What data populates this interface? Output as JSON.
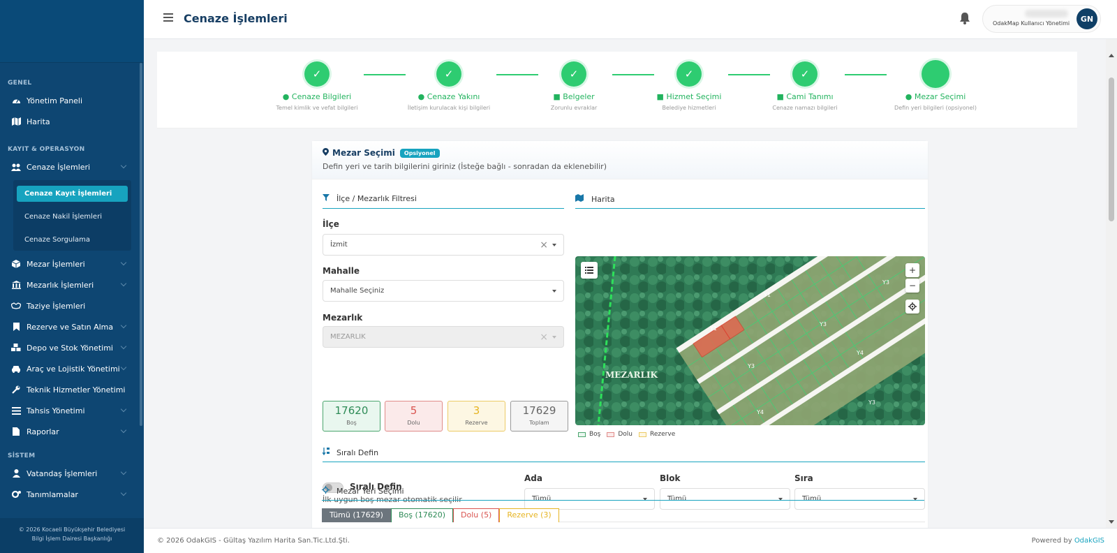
{
  "header": {
    "title": "Cenaze İşlemleri",
    "user_role": "OdakMap Kullanıcı Yönetimi",
    "avatar_initials": "GN"
  },
  "sidebar": {
    "sections": [
      "GENEL",
      "KAYIT & OPERASYON",
      "SİSTEM"
    ],
    "genel": [
      {
        "label": "Yönetim Paneli",
        "icon": "dashboard-icon"
      },
      {
        "label": "Harita",
        "icon": "map-icon"
      }
    ],
    "kayit": [
      {
        "label": "Cenaze İşlemleri",
        "icon": "users-icon"
      },
      {
        "label": "Mezar İşlemleri",
        "icon": "cube-icon"
      },
      {
        "label": "Mezarlık İşlemleri",
        "icon": "bank-icon"
      },
      {
        "label": "Taziye İşlemleri",
        "icon": "handshake-icon"
      },
      {
        "label": "Rezerve ve Satın Alma",
        "icon": "bookmark-icon"
      },
      {
        "label": "Depo ve Stok Yönetimi",
        "icon": "boxes-icon"
      },
      {
        "label": "Araç ve Lojistik Yönetimi",
        "icon": "car-icon"
      },
      {
        "label": "Teknik Hizmetler Yönetimi",
        "icon": "wrench-icon"
      },
      {
        "label": "Tahsis Yönetimi",
        "icon": "list-icon"
      },
      {
        "label": "Raporlar",
        "icon": "file-icon"
      }
    ],
    "submenu": [
      "Cenaze Kayıt İşlemleri",
      "Cenaze Nakil İşlemleri",
      "Cenaze Sorgulama"
    ],
    "sistem": [
      {
        "label": "Vatandaş İşlemleri",
        "icon": "user-icon"
      },
      {
        "label": "Tanımlamalar",
        "icon": "cogs-icon"
      }
    ],
    "footer_line1": "© 2026 Kocaeli Büyükşehir Belediyesi",
    "footer_line2": "Bilgi İşlem Dairesi Başkanlığı"
  },
  "steps": [
    {
      "label": "Cenaze Bilgileri",
      "sub": "Temel kimlik ve vefat bilgileri",
      "icon": "user-icon"
    },
    {
      "label": "Cenaze Yakını",
      "sub": "İletişim kurulacak kişi bilgileri",
      "icon": "users-icon"
    },
    {
      "label": "Belgeler",
      "sub": "Zorunlu evraklar",
      "icon": "file-icon"
    },
    {
      "label": "Hizmet Seçimi",
      "sub": "Belediye hizmetleri",
      "icon": "truck-icon"
    },
    {
      "label": "Cami Tanımı",
      "sub": "Cenaze namazı bilgileri",
      "icon": "building-icon"
    },
    {
      "label": "Mezar Seçimi",
      "sub": "Defin yeri bilgileri (opsiyonel)",
      "icon": "pin-icon"
    }
  ],
  "card": {
    "title": "Mezar Seçimi",
    "badge": "Opsiyonel",
    "desc": "Defin yeri ve tarih bilgilerini giriniz (İsteğe bağlı - sonradan da eklenebilir)"
  },
  "filter": {
    "title": "İlçe / Mezarlık Filtresi",
    "ilce_label": "İlçe",
    "ilce_value": "İzmit",
    "mahalle_label": "Mahalle",
    "mahalle_value": "Mahalle Seçiniz",
    "mezarlik_label": "Mezarlık",
    "mezarlik_value": "MEZARLIK"
  },
  "stats": [
    {
      "value": "17620",
      "caption": "Boş",
      "color": "#2e8b57",
      "bg": "#e9f7ef",
      "border": "#4aa56d"
    },
    {
      "value": "5",
      "caption": "Dolu",
      "color": "#d9534f",
      "bg": "#fbeaea",
      "border": "#e08b89"
    },
    {
      "value": "3",
      "caption": "Rezerve",
      "color": "#e6b422",
      "bg": "#fdf7e3",
      "border": "#eccb66"
    },
    {
      "value": "17629",
      "caption": "Toplam",
      "color": "#666666",
      "bg": "#f5f5f5",
      "border": "#999999"
    }
  ],
  "map": {
    "title": "Harita",
    "zoom_in": "+",
    "zoom_out": "−",
    "cemetery_label": "MEZARLIK",
    "road_labels": [
      "Y1",
      "Y1",
      "Y3",
      "Y3",
      "Y4",
      "Y4",
      "Y3",
      "Y3"
    ],
    "legend": [
      "Boş",
      "Dolu",
      "Rezerve"
    ]
  },
  "sirali": {
    "title": "Sıralı Defin",
    "toggle_label": "Sıralı Defin",
    "toggle_desc": "İlk uygun boş mezar otomatik seçilir",
    "ada_label": "Ada",
    "ada_value": "Tümü",
    "blok_label": "Blok",
    "blok_value": "Tümü",
    "sira_label": "Sıra",
    "sira_value": "Tümü"
  },
  "mezar_yeri": {
    "title": "Mezar Yeri Seçimi",
    "tabs": [
      "Tümü (17629)",
      "Boş (17620)",
      "Dolu (5)",
      "Rezerve (3)"
    ]
  },
  "footer": {
    "left": "© 2026 OdakGIS - Gültaş Yazılım Harita San.Tic.Ltd.Şti.",
    "powered": "Powered by",
    "brand": "OdakGIS"
  }
}
